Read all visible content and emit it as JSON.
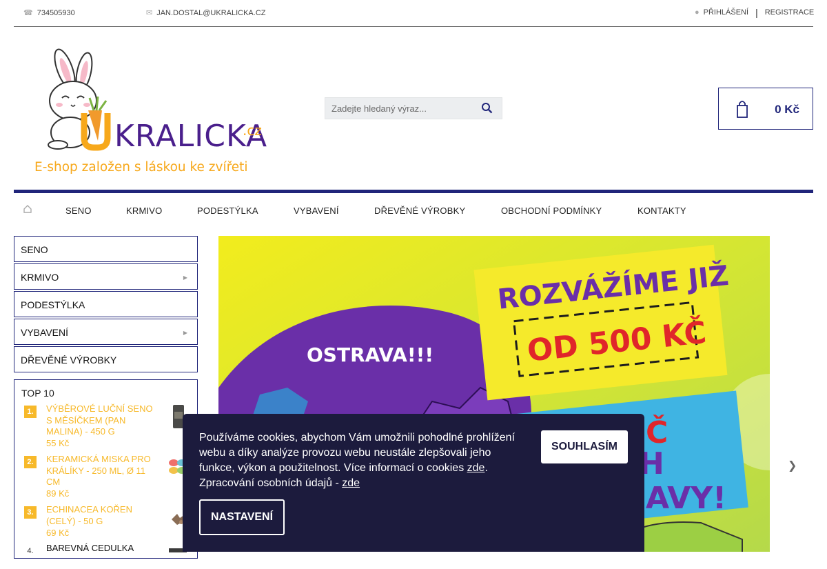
{
  "topbar": {
    "phone": "734505930",
    "email": "JAN.DOSTAL@UKRALICKA.CZ",
    "login": "PŘIHLÁŠENÍ",
    "separator": "|",
    "register": "REGISTRACE"
  },
  "logo": {
    "wordmark_u": "U",
    "wordmark_rest": "KRALICKA",
    "wordmark_tld": ".cz",
    "tagline": "E-shop založen s láskou ke zvířeti"
  },
  "search": {
    "placeholder": "Zadejte hledaný výraz..."
  },
  "cart": {
    "total": "0 Kč"
  },
  "nav": {
    "items": [
      "SENO",
      "KRMIVO",
      "PODESTÝLKA",
      "VYBAVENÍ",
      "DŘEVĚNÉ VÝROBKY",
      "OBCHODNÍ PODMÍNKY",
      "KONTAKTY"
    ]
  },
  "sidebar": {
    "categories": [
      {
        "label": "SENO",
        "has_children": false
      },
      {
        "label": "KRMIVO",
        "has_children": true
      },
      {
        "label": "PODESTÝLKA",
        "has_children": false
      },
      {
        "label": "VYBAVENÍ",
        "has_children": true
      },
      {
        "label": "DŘEVĚNÉ VÝROBKY",
        "has_children": false
      }
    ],
    "top10": {
      "title": "TOP 10",
      "products": [
        {
          "rank": "1.",
          "name": "VÝBĚROVÉ LUČNÍ SENO S MĚSÍČKEM (PAN MALINA) - 450 G",
          "price": "55 Kč"
        },
        {
          "rank": "2.",
          "name": "KERAMICKÁ MISKA PRO KRÁLÍKY - 250 ML, Ø 11 CM",
          "price": "89 Kč"
        },
        {
          "rank": "3.",
          "name": "ECHINACEA KOŘEN (CELÝ) - 50 G",
          "price": "69 Kč"
        },
        {
          "rank": "4.",
          "name": "BAREVNÁ CEDULKA",
          "price": ""
        }
      ]
    }
  },
  "banner": {
    "headline_1": "ROZVÁŽÍME JIŽ",
    "headline_2": "OD 500 KČ",
    "city": "OSTRAVA!!!",
    "partial_1": "Č",
    "partial_2": "H",
    "partial_3": "AVY!"
  },
  "cookie": {
    "text_before": "Používáme cookies, abychom Vám umožnili pohodlné prohlížení webu a díky analýze provozu webu neustále zlepšovali jeho funkce, výkon a použitelnost. Více informací o cookies ",
    "link_1": "zde",
    "text_middle": ". Zpracování osobních údajů - ",
    "link_2": "zde",
    "agree_label": "SOUHLASÍM",
    "settings_label": "NASTAVENÍ"
  },
  "colors": {
    "brand_navy": "#20257a",
    "brand_orange": "#f7b92a",
    "cookie_bg": "#1c1b3d",
    "banner_purple": "#6a2fa8",
    "banner_yellow": "#f5ea2b"
  }
}
